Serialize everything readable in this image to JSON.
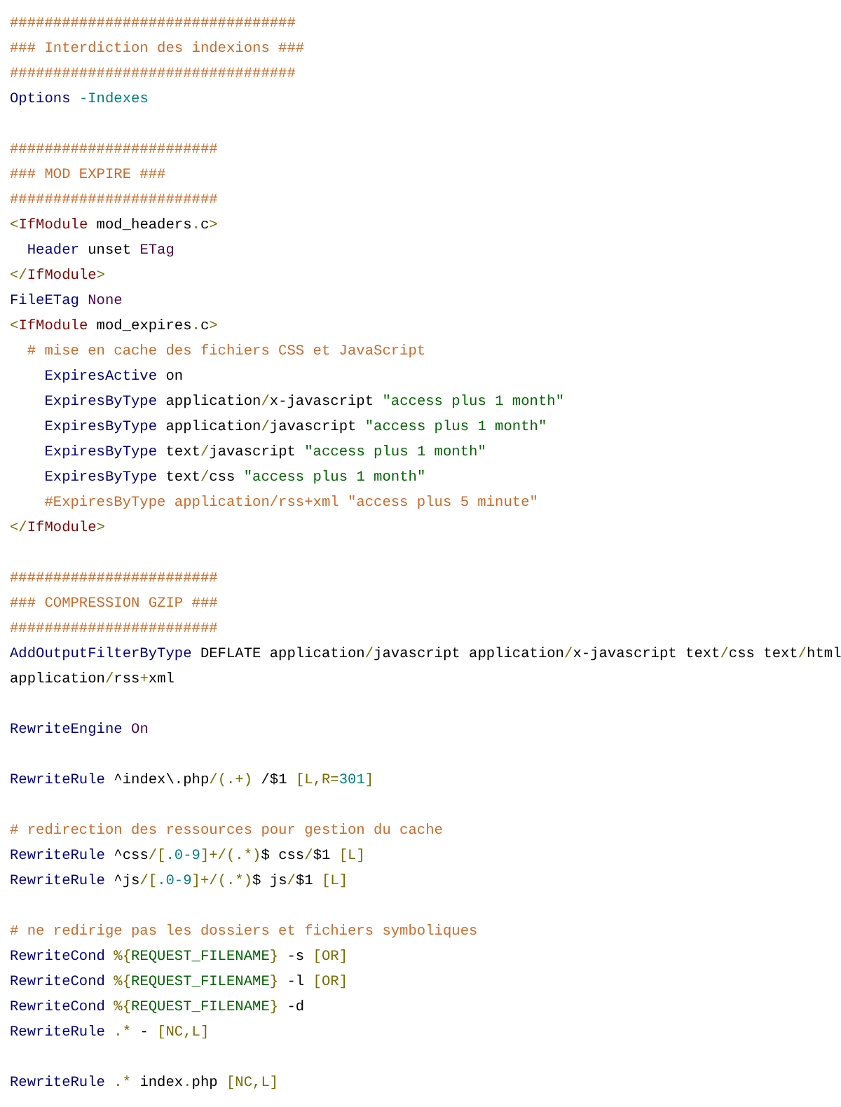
{
  "lines": [
    {
      "kind": "code",
      "tokens": [
        {
          "kind": "comment",
          "text": "#################################"
        }
      ]
    },
    {
      "kind": "code",
      "tokens": [
        {
          "kind": "comment",
          "text": "### Interdiction des indexions ###"
        }
      ]
    },
    {
      "kind": "code",
      "tokens": [
        {
          "kind": "comment",
          "text": "#################################"
        }
      ]
    },
    {
      "kind": "code",
      "tokens": [
        {
          "kind": "directive",
          "text": "Options "
        },
        {
          "kind": "number",
          "text": "-Indexes"
        }
      ]
    },
    {
      "kind": "blank"
    },
    {
      "kind": "code",
      "tokens": [
        {
          "kind": "comment",
          "text": "########################"
        }
      ]
    },
    {
      "kind": "code",
      "tokens": [
        {
          "kind": "comment",
          "text": "### MOD EXPIRE ###"
        }
      ]
    },
    {
      "kind": "code",
      "tokens": [
        {
          "kind": "comment",
          "text": "########################"
        }
      ]
    },
    {
      "kind": "code",
      "tokens": [
        {
          "kind": "punct",
          "text": "<"
        },
        {
          "kind": "tag",
          "text": "IfModule"
        },
        {
          "kind": "plain",
          "text": " mod_headers"
        },
        {
          "kind": "punct",
          "text": "."
        },
        {
          "kind": "plain",
          "text": "c"
        },
        {
          "kind": "punct",
          "text": ">"
        }
      ]
    },
    {
      "kind": "code",
      "tokens": [
        {
          "kind": "directive",
          "text": "  Header"
        },
        {
          "kind": "plain",
          "text": " unset "
        },
        {
          "kind": "keyword",
          "text": "ETag"
        }
      ]
    },
    {
      "kind": "code",
      "tokens": [
        {
          "kind": "punct",
          "text": "</"
        },
        {
          "kind": "tag",
          "text": "IfModule"
        },
        {
          "kind": "punct",
          "text": ">"
        }
      ]
    },
    {
      "kind": "code",
      "tokens": [
        {
          "kind": "directive",
          "text": "FileETag "
        },
        {
          "kind": "keyword",
          "text": "None"
        }
      ]
    },
    {
      "kind": "code",
      "tokens": [
        {
          "kind": "punct",
          "text": "<"
        },
        {
          "kind": "tag",
          "text": "IfModule"
        },
        {
          "kind": "plain",
          "text": " mod_expires"
        },
        {
          "kind": "punct",
          "text": "."
        },
        {
          "kind": "plain",
          "text": "c"
        },
        {
          "kind": "punct",
          "text": ">"
        }
      ]
    },
    {
      "kind": "code",
      "tokens": [
        {
          "kind": "comment",
          "text": "  # mise en cache des fichiers CSS et JavaScript"
        }
      ]
    },
    {
      "kind": "code",
      "tokens": [
        {
          "kind": "directive",
          "text": "    ExpiresActive"
        },
        {
          "kind": "plain",
          "text": " on"
        }
      ]
    },
    {
      "kind": "code",
      "tokens": [
        {
          "kind": "directive",
          "text": "    ExpiresByType"
        },
        {
          "kind": "plain",
          "text": " application"
        },
        {
          "kind": "punct",
          "text": "/"
        },
        {
          "kind": "plain",
          "text": "x-javascript "
        },
        {
          "kind": "string",
          "text": "\"access plus 1 month\""
        }
      ]
    },
    {
      "kind": "code",
      "tokens": [
        {
          "kind": "directive",
          "text": "    ExpiresByType"
        },
        {
          "kind": "plain",
          "text": " application"
        },
        {
          "kind": "punct",
          "text": "/"
        },
        {
          "kind": "plain",
          "text": "javascript "
        },
        {
          "kind": "string",
          "text": "\"access plus 1 month\""
        }
      ]
    },
    {
      "kind": "code",
      "tokens": [
        {
          "kind": "directive",
          "text": "    ExpiresByType"
        },
        {
          "kind": "plain",
          "text": " text"
        },
        {
          "kind": "punct",
          "text": "/"
        },
        {
          "kind": "plain",
          "text": "javascript "
        },
        {
          "kind": "string",
          "text": "\"access plus 1 month\""
        }
      ]
    },
    {
      "kind": "code",
      "tokens": [
        {
          "kind": "directive",
          "text": "    ExpiresByType"
        },
        {
          "kind": "plain",
          "text": " text"
        },
        {
          "kind": "punct",
          "text": "/"
        },
        {
          "kind": "plain",
          "text": "css "
        },
        {
          "kind": "string",
          "text": "\"access plus 1 month\""
        }
      ]
    },
    {
      "kind": "code",
      "tokens": [
        {
          "kind": "comment",
          "text": "    #ExpiresByType application/rss+xml \"access plus 5 minute\""
        }
      ]
    },
    {
      "kind": "code",
      "tokens": [
        {
          "kind": "punct",
          "text": "</"
        },
        {
          "kind": "tag",
          "text": "IfModule"
        },
        {
          "kind": "punct",
          "text": ">"
        }
      ]
    },
    {
      "kind": "blank"
    },
    {
      "kind": "code",
      "tokens": [
        {
          "kind": "comment",
          "text": "########################"
        }
      ]
    },
    {
      "kind": "code",
      "tokens": [
        {
          "kind": "comment",
          "text": "### COMPRESSION GZIP ###"
        }
      ]
    },
    {
      "kind": "code",
      "tokens": [
        {
          "kind": "comment",
          "text": "########################"
        }
      ]
    },
    {
      "kind": "code",
      "tokens": [
        {
          "kind": "directive",
          "text": "AddOutputFilterByType"
        },
        {
          "kind": "plain",
          "text": " DEFLATE application"
        },
        {
          "kind": "punct",
          "text": "/"
        },
        {
          "kind": "plain",
          "text": "javascript application"
        },
        {
          "kind": "punct",
          "text": "/"
        },
        {
          "kind": "plain",
          "text": "x-javascript text"
        },
        {
          "kind": "punct",
          "text": "/"
        },
        {
          "kind": "plain",
          "text": "css text"
        },
        {
          "kind": "punct",
          "text": "/"
        },
        {
          "kind": "plain",
          "text": "html"
        }
      ]
    },
    {
      "kind": "code",
      "tokens": [
        {
          "kind": "plain",
          "text": "application"
        },
        {
          "kind": "punct",
          "text": "/"
        },
        {
          "kind": "plain",
          "text": "rss"
        },
        {
          "kind": "punct",
          "text": "+"
        },
        {
          "kind": "plain",
          "text": "xml"
        }
      ]
    },
    {
      "kind": "blank"
    },
    {
      "kind": "code",
      "tokens": [
        {
          "kind": "directive",
          "text": "RewriteEngine "
        },
        {
          "kind": "keyword",
          "text": "On"
        }
      ]
    },
    {
      "kind": "blank"
    },
    {
      "kind": "code",
      "tokens": [
        {
          "kind": "directive",
          "text": "RewriteRule "
        },
        {
          "kind": "plain",
          "text": "^index\\.php"
        },
        {
          "kind": "punct",
          "text": "/(.+)"
        },
        {
          "kind": "plain",
          "text": " /$1 "
        },
        {
          "kind": "punct",
          "text": "[L,R="
        },
        {
          "kind": "number",
          "text": "301"
        },
        {
          "kind": "punct",
          "text": "]"
        }
      ]
    },
    {
      "kind": "blank"
    },
    {
      "kind": "code",
      "tokens": [
        {
          "kind": "comment",
          "text": "# redirection des ressources pour gestion du cache"
        }
      ]
    },
    {
      "kind": "code",
      "tokens": [
        {
          "kind": "directive",
          "text": "RewriteRule "
        },
        {
          "kind": "plain",
          "text": "^css"
        },
        {
          "kind": "punct",
          "text": "/["
        },
        {
          "kind": "number",
          "text": ".0-9"
        },
        {
          "kind": "punct",
          "text": "]+/(.*)"
        },
        {
          "kind": "plain",
          "text": "$ css"
        },
        {
          "kind": "punct",
          "text": "/"
        },
        {
          "kind": "plain",
          "text": "$1 "
        },
        {
          "kind": "punct",
          "text": "[L]"
        }
      ]
    },
    {
      "kind": "code",
      "tokens": [
        {
          "kind": "directive",
          "text": "RewriteRule "
        },
        {
          "kind": "plain",
          "text": "^js"
        },
        {
          "kind": "punct",
          "text": "/["
        },
        {
          "kind": "number",
          "text": ".0-9"
        },
        {
          "kind": "punct",
          "text": "]+/(.*)"
        },
        {
          "kind": "plain",
          "text": "$ js"
        },
        {
          "kind": "punct",
          "text": "/"
        },
        {
          "kind": "plain",
          "text": "$1 "
        },
        {
          "kind": "punct",
          "text": "[L]"
        }
      ]
    },
    {
      "kind": "blank"
    },
    {
      "kind": "code",
      "tokens": [
        {
          "kind": "comment",
          "text": "# ne redirige pas les dossiers et fichiers symboliques"
        }
      ]
    },
    {
      "kind": "code",
      "tokens": [
        {
          "kind": "directive",
          "text": "RewriteCond "
        },
        {
          "kind": "punct",
          "text": "%{"
        },
        {
          "kind": "variable",
          "text": "REQUEST_FILENAME"
        },
        {
          "kind": "punct",
          "text": "}"
        },
        {
          "kind": "plain",
          "text": " -s "
        },
        {
          "kind": "punct",
          "text": "[OR]"
        }
      ]
    },
    {
      "kind": "code",
      "tokens": [
        {
          "kind": "directive",
          "text": "RewriteCond "
        },
        {
          "kind": "punct",
          "text": "%{"
        },
        {
          "kind": "variable",
          "text": "REQUEST_FILENAME"
        },
        {
          "kind": "punct",
          "text": "}"
        },
        {
          "kind": "plain",
          "text": " -l "
        },
        {
          "kind": "punct",
          "text": "[OR]"
        }
      ]
    },
    {
      "kind": "code",
      "tokens": [
        {
          "kind": "directive",
          "text": "RewriteCond "
        },
        {
          "kind": "punct",
          "text": "%{"
        },
        {
          "kind": "variable",
          "text": "REQUEST_FILENAME"
        },
        {
          "kind": "punct",
          "text": "}"
        },
        {
          "kind": "plain",
          "text": " -d"
        }
      ]
    },
    {
      "kind": "code",
      "tokens": [
        {
          "kind": "directive",
          "text": "RewriteRule "
        },
        {
          "kind": "punct",
          "text": ".*"
        },
        {
          "kind": "plain",
          "text": " - "
        },
        {
          "kind": "punct",
          "text": "[NC,L]"
        }
      ]
    },
    {
      "kind": "blank"
    },
    {
      "kind": "code",
      "tokens": [
        {
          "kind": "directive",
          "text": "RewriteRule "
        },
        {
          "kind": "punct",
          "text": ".*"
        },
        {
          "kind": "plain",
          "text": " index"
        },
        {
          "kind": "punct",
          "text": "."
        },
        {
          "kind": "plain",
          "text": "php "
        },
        {
          "kind": "punct",
          "text": "[NC,L]"
        }
      ]
    }
  ]
}
